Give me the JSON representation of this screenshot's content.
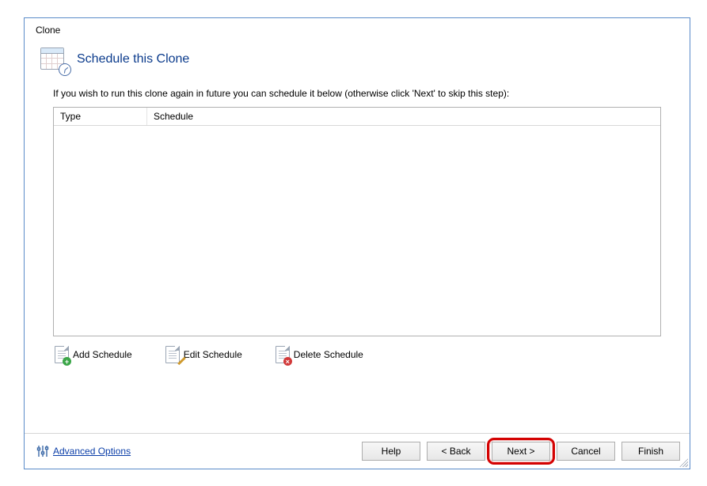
{
  "window": {
    "title": "Clone"
  },
  "header": {
    "heading": "Schedule this Clone"
  },
  "instruction": "If you wish to run this clone again in future you can schedule it below (otherwise click 'Next' to skip this step):",
  "grid": {
    "columns": {
      "type": "Type",
      "schedule": "Schedule"
    },
    "rows": []
  },
  "toolbar": {
    "add": "Add Schedule",
    "edit": "Edit Schedule",
    "delete": "Delete Schedule"
  },
  "footer": {
    "advanced": "Advanced Options",
    "help": "Help",
    "back": "< Back",
    "next": "Next >",
    "cancel": "Cancel",
    "finish": "Finish"
  }
}
